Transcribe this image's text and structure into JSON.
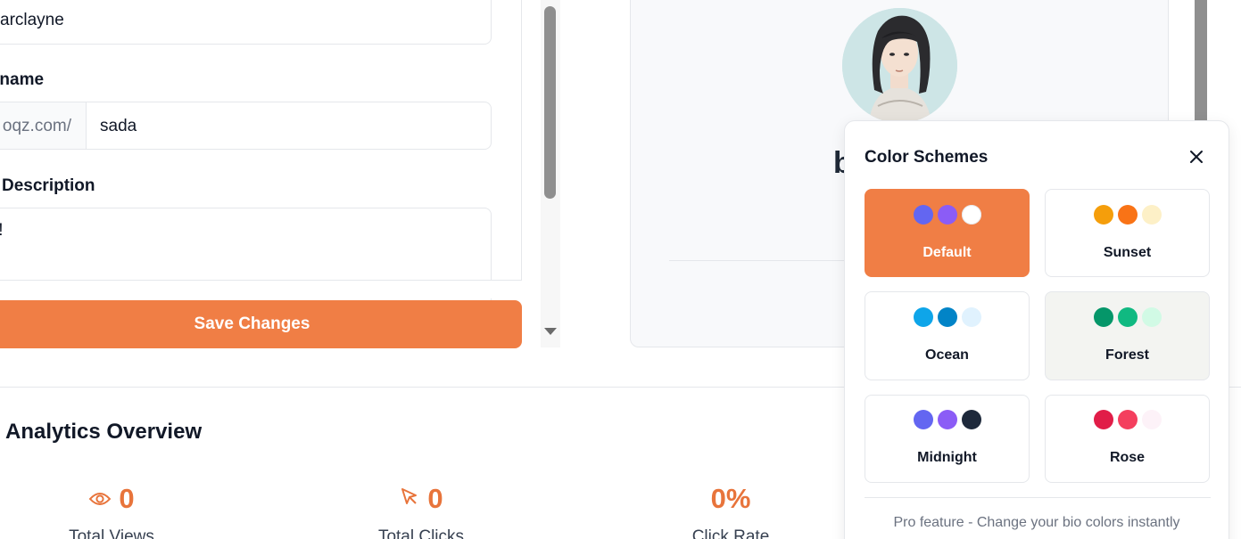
{
  "editor": {
    "name_value": "arclayne",
    "username_label": "rname",
    "username_prefix": "oqz.com/",
    "username_value": "sada",
    "description_label": "Description",
    "description_value": "i!",
    "save_label": "Save Changes"
  },
  "preview": {
    "name_fragment": "b"
  },
  "analytics": {
    "title": "Analytics Overview",
    "stats": [
      {
        "icon": "eye-icon",
        "value": "0",
        "label": "Total Views"
      },
      {
        "icon": "cursor-click-icon",
        "value": "0",
        "label": "Total Clicks"
      },
      {
        "icon": "",
        "value": "0%",
        "label": "Click Rate"
      }
    ]
  },
  "color_schemes": {
    "title": "Color Schemes",
    "close_icon": "close-icon",
    "selected": "Default",
    "items": [
      {
        "name": "Default",
        "colors": [
          "#6366f1",
          "#8b5cf6",
          "#ffffff"
        ]
      },
      {
        "name": "Sunset",
        "colors": [
          "#f59e0b",
          "#f97316",
          "#fdf0c7"
        ]
      },
      {
        "name": "Ocean",
        "colors": [
          "#0ea5e9",
          "#0284c7",
          "#e0f2fe"
        ]
      },
      {
        "name": "Forest",
        "colors": [
          "#059669",
          "#10b981",
          "#d1fae5"
        ]
      },
      {
        "name": "Midnight",
        "colors": [
          "#6366f1",
          "#8b5cf6",
          "#1e293b"
        ]
      },
      {
        "name": "Rose",
        "colors": [
          "#e11d48",
          "#f43f5e",
          "#fdf2f8"
        ]
      }
    ],
    "footer": "Pro feature - Change your bio colors instantly"
  },
  "colors": {
    "accent": "#f07e45",
    "accent_text": "#e8743b"
  }
}
